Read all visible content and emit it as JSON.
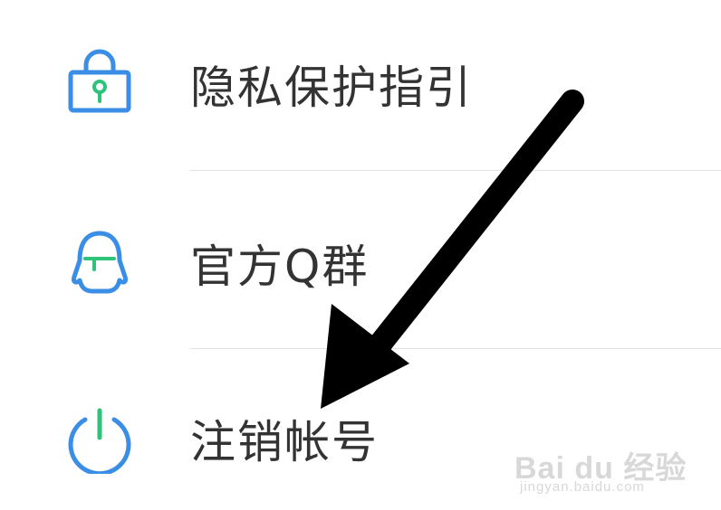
{
  "menu": {
    "items": [
      {
        "label": "隐私保护指引",
        "icon": "lock-icon"
      },
      {
        "label": "官方Q群",
        "icon": "qq-penguin-icon"
      },
      {
        "label": "注销帐号",
        "icon": "power-icon"
      }
    ]
  },
  "colors": {
    "icon_blue": "#3a8ee6",
    "icon_green": "#2fc27a",
    "text": "#333333",
    "divider": "#e2e2e2",
    "arrow": "#000000"
  },
  "watermark": {
    "text": "Bai du 经验",
    "url_text": "jingyan.baidu.com"
  }
}
